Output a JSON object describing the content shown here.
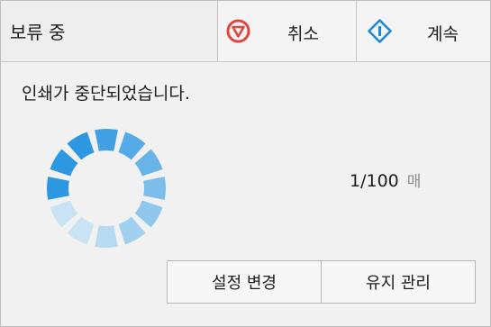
{
  "toolbar": {
    "status_label": "보류 중",
    "cancel_label": "취소",
    "continue_label": "계속"
  },
  "message": "인쇄가 중단되었습니다.",
  "progress": {
    "count": "1/100",
    "unit": "매"
  },
  "actions": {
    "change_settings_label": "설정 변경",
    "maintenance_label": "유지 관리"
  },
  "icons": {
    "cancel": "stop-circle-icon",
    "continue": "resume-diamond-icon",
    "spinner": "progress-spinner-icon"
  },
  "colors": {
    "cancel_icon": "#e0473c",
    "continue_icon": "#1e88d8",
    "spinner_dark": "#2e97e2",
    "spinner_light": "#c9e3f4"
  }
}
